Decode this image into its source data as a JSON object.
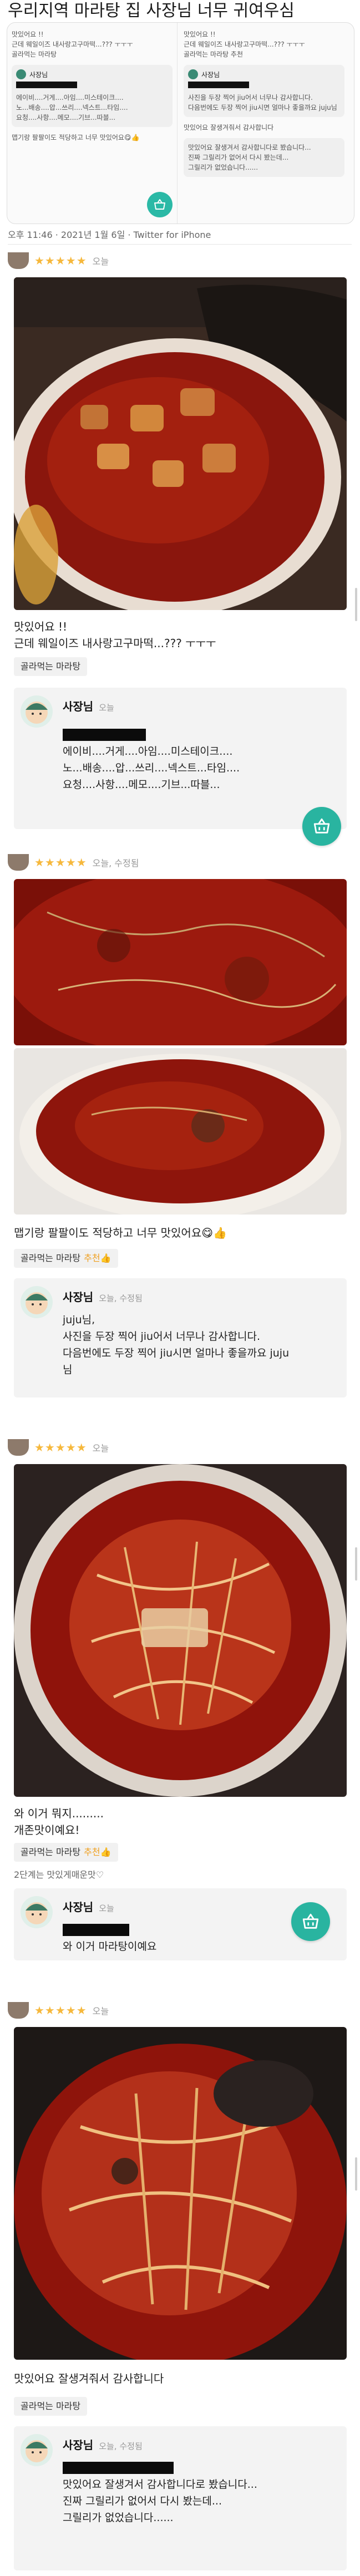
{
  "post": {
    "title": "우리지역 마라탕 집 사장님 너무 귀여우심",
    "meta": "오후 11:46 · 2021년 1월 6일 · Twitter for iPhone"
  },
  "tweet_preview": {
    "left_lines": [
      "맛있어요 !!",
      "근데 웨일이즈 내사랑고구마떡...??? ㅜㅜㅜ",
      "골라먹는 마라탕"
    ],
    "left_owner": "사장님",
    "left_reply_lines": [
      "에이비....거게....아임....미스테이크....",
      "노...배송....압...쓰리....넥스트...타임....",
      "요청....사항....메모....기브...따블..."
    ],
    "left_bottom": "맵기랑 팔팔이도 적당하고 너무 맛있어요😋👍",
    "right_lines": [
      "맛있어요 !!",
      "근데 웨일이즈 내사랑고구마떡...??? ㅜㅜㅜ",
      "골라먹는 마라탕 추천"
    ],
    "right_owner": "사장님",
    "right_reply_lines": [
      "사진을 두장 찍어 jiu어서 너무나 감사합니다.",
      "다음번에도 두장 찍어 jiu시면 얼마나 좋을까요 juju님"
    ],
    "right_bottom": [
      "맛있어요 잘생겨줘서 감사합니다",
      "맛있어요 잘생겨서 감사합니다로 봤습니다...",
      "진짜 그릴리가 없어서 다시 봤는데...",
      "그릴리가 없었습니다......"
    ]
  },
  "reviews": [
    {
      "rating": "★★★★★",
      "date": "오늘",
      "text": [
        "맛있어요 !!",
        "근데 웨일이즈 내사랑고구마떡...??? ㅜㅜㅜ"
      ],
      "menu": "골라먹는 마라탕",
      "recommend": "",
      "owner": {
        "name": "사장님",
        "date": "오늘",
        "lines": [
          "에이비....거게....아임....미스테이크....",
          "노...배송....압...쓰리....넥스트...타임....",
          "요청....사항....메모....기브...따블..."
        ]
      }
    },
    {
      "rating": "★★★★★",
      "date": "오늘, 수정됨",
      "text": [
        "맵기랑 팔팔이도 적당하고 너무 맛있어요😋👍"
      ],
      "menu": "골라먹는 마라탕",
      "recommend": "추천👍",
      "owner": {
        "name": "사장님",
        "date": "오늘, 수정됨",
        "lines": [
          "juju님,",
          "사진을 두장 찍어 jiu어서 너무나 감사합니다.",
          "다음번에도 두장 찍어 jiu시면 얼마나 좋을까요 juju",
          "님"
        ]
      }
    },
    {
      "rating": "★★★★★",
      "date": "오늘",
      "text": [
        "와 이거 뭐지.........",
        "개존맛이예요!"
      ],
      "menu": "골라먹는 마라탕",
      "recommend": "추천👍",
      "sub_note": "2단계는 맛있게매운맛♡",
      "owner": {
        "name": "사장님",
        "date": "오늘",
        "lines": [
          "와 이거 마라탕이예요"
        ]
      }
    },
    {
      "rating": "★★★★★",
      "date": "오늘",
      "text": [
        "맛있어요 잘생겨줘서 감사합니다"
      ],
      "menu": "골라먹는 마라탕",
      "recommend": "",
      "owner": {
        "name": "사장님",
        "date": "오늘, 수정됨",
        "lines": [
          "맛있어요 잘생겨서 감사합니다로 봤습니다...",
          "진짜 그릴리가 없어서 다시 봤는데...",
          "그릴리가 없었습니다......"
        ]
      }
    }
  ],
  "icons": {
    "cart": "shopping-basket-icon",
    "star": "star-icon"
  },
  "colors": {
    "accent": "#29b4a0",
    "star": "#f6b83c",
    "broth": "#9b1a10"
  }
}
